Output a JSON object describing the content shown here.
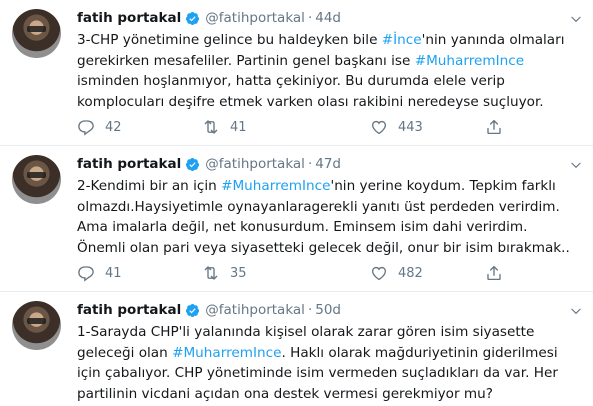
{
  "tweets": [
    {
      "name": "fatih portakal",
      "handle": "@fatihportakal",
      "dot": "·",
      "time": "44d",
      "text": {
        "p1": "3-CHP yönetimine gelince bu haldeyken bile ",
        "tag1": "#İnce",
        "p2": "'nin yanında olmaları gerekirken mesafeliler. Partinin genel başkanı ise ",
        "tag2": "#MuharremInce",
        "p3": " isminden hoşlanmıyor, hatta çekiniyor. Bu durumda elele verip komplocuları deşifre etmek varken olası rakibini neredeyse suçluyor."
      },
      "replies": "42",
      "retweets": "41",
      "likes": "443"
    },
    {
      "name": "fatih portakal",
      "handle": "@fatihportakal",
      "dot": "·",
      "time": "47d",
      "text": {
        "p1": "2-Kendimi bir an için ",
        "tag1": "#MuharremInce",
        "p2": "'nin yerine koydum. Tepkim farklı olmazdı.Haysiyetimle oynayanlaragerekli yanıtı üst perdeden verirdim. Ama imalarla değil, net konusurdum. Eminsem isim dahi verirdim. Önemli olan pari veya siyasetteki gelecek değil, onur bir isim bırakmak.."
      },
      "replies": "41",
      "retweets": "35",
      "likes": "482"
    },
    {
      "name": "fatih portakal",
      "handle": "@fatihportakal",
      "dot": "·",
      "time": "50d",
      "text": {
        "p1": "1-Sarayda CHP'li yalanında kişisel olarak zarar gören isim siyasette geleceği olan ",
        "tag1": "#MuharremInce",
        "p2": ". Haklı olarak mağduriyetinin giderilmesi için çabalıyor. CHP yönetiminde isim vermeden suçladıkları da var. Her partilinin vicdani açıdan ona destek vermesi gerekmiyor mu?"
      }
    }
  ],
  "colors": {
    "link": "#1da1f2",
    "verified": "#1da1f2",
    "muted": "#657786"
  }
}
